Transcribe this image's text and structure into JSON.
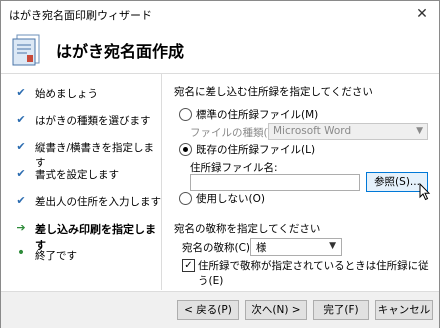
{
  "window": {
    "title": "はがき宛名面印刷ウィザード",
    "close_icon": "close-icon"
  },
  "header": {
    "title": "はがき宛名面作成",
    "icon": "postcard-wizard-icon"
  },
  "steps": [
    {
      "label": "始めましょう",
      "state": "done",
      "mark": "✔"
    },
    {
      "label": "はがきの種類を選びます",
      "state": "done",
      "mark": "✔"
    },
    {
      "label": "縦書き/横書きを指定します",
      "state": "done",
      "mark": "✔"
    },
    {
      "label": "書式を設定します",
      "state": "done",
      "mark": "✔"
    },
    {
      "label": "差出人の住所を入力します",
      "state": "done",
      "mark": "✔"
    },
    {
      "label": "差し込み印刷を指定します",
      "state": "current",
      "mark": "➔"
    },
    {
      "label": "終了です",
      "state": "pending",
      "mark": "•"
    }
  ],
  "address_source": {
    "heading": "宛名に差し込む住所録を指定してください",
    "option_standard": "標準の住所録ファイル(M)",
    "file_type_label": "ファイルの種類(T):",
    "file_type_value": "Microsoft Word",
    "option_existing": "既存の住所録ファイル(L)",
    "file_name_label": "住所録ファイル名:",
    "file_name_value": "",
    "browse_button": "参照(S)...",
    "option_none": "使用しない(O)",
    "selected": "existing"
  },
  "honorific": {
    "heading": "宛名の敬称を指定してください",
    "label": "宛名の敬称(C):",
    "value": "様",
    "checkbox_label": "住所録で敬称が指定されているときは住所録に従う(E)",
    "checkbox_checked": true,
    "check_mark": "✓"
  },
  "footer": {
    "back": "< 戻る(P)",
    "next": "次へ(N) >",
    "finish": "完了(F)",
    "cancel": "キャンセル"
  }
}
